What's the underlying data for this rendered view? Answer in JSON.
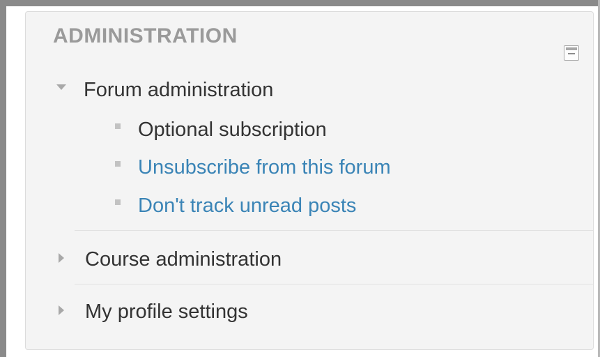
{
  "block": {
    "title": "ADMINISTRATION",
    "control_icon": "collapse-icon",
    "bullet_color": "#c2c2c2",
    "link_color": "#3a84b6"
  },
  "tree": {
    "forum_admin": {
      "label": "Forum administration",
      "expanded": true,
      "items": [
        {
          "label": "Optional subscription",
          "is_link": false
        },
        {
          "label": "Unsubscribe from this forum",
          "is_link": true
        },
        {
          "label": "Don't track unread posts",
          "is_link": true
        }
      ]
    },
    "course_admin": {
      "label": "Course administration",
      "expanded": false
    },
    "profile_settings": {
      "label": "My profile settings",
      "expanded": false
    }
  }
}
